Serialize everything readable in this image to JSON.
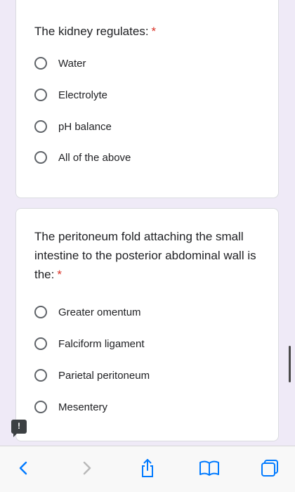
{
  "form": {
    "questions": [
      {
        "text": "The kidney regulates:",
        "required_mark": "*",
        "options": [
          "Water",
          "Electrolyte",
          "pH balance",
          "All of the above"
        ]
      },
      {
        "text": "The peritoneum fold attaching the small intestine to the posterior abdominal wall is the:",
        "required_mark": "*",
        "options": [
          "Greater omentum",
          "Falciform ligament",
          "Parietal peritoneum",
          "Mesentery"
        ]
      }
    ]
  },
  "feedback_badge": "!",
  "toolbar": {
    "buttons": [
      "back-icon",
      "forward-icon",
      "share-icon",
      "bookmarks-icon",
      "tabs-icon"
    ]
  },
  "colors": {
    "page_background": "#efeaf7",
    "required": "#d93025",
    "toolbar_icon": "#007aff",
    "toolbar_icon_disabled": "#b8b8b8"
  }
}
